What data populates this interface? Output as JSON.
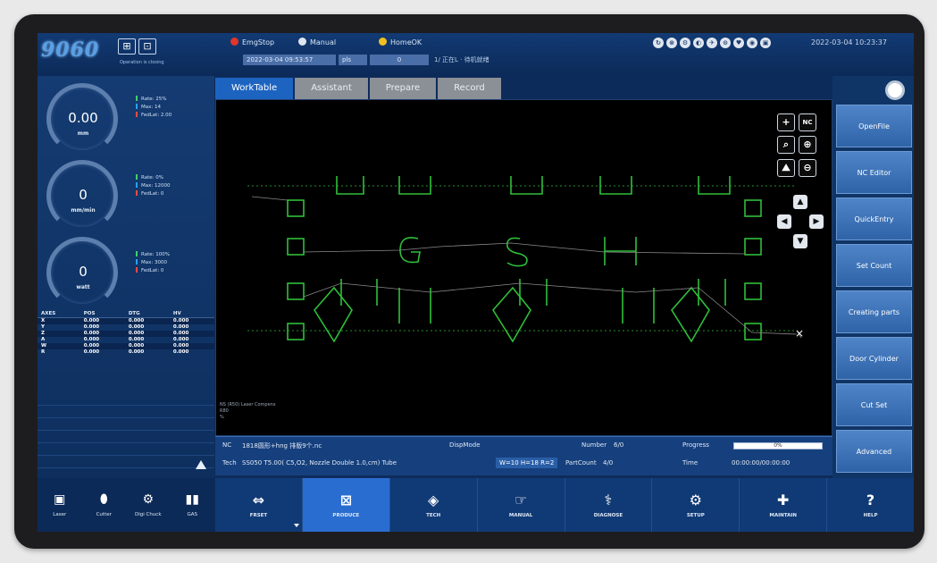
{
  "app": {
    "logo_text": "9060",
    "lock_caption": "Operation is closing"
  },
  "topbar": {
    "chips": [
      {
        "label": "EmgStop",
        "color": "#e0362b"
      },
      {
        "label": "Manual",
        "color": "#dfe6ef"
      },
      {
        "label": "HomeOK",
        "color": "#f0c020"
      }
    ],
    "time_field": "2022-03-04 09:53:57",
    "mode_field": "pls",
    "value_field": "0",
    "status_text": "1/ 正在L · 待机就绪",
    "datetime": "2022-03-04 10:23:37",
    "sys_icons": [
      "↻",
      "⊗",
      "⚙",
      "◐",
      "✈",
      "⊙",
      "♥",
      "◉",
      "▣"
    ]
  },
  "gauges": [
    {
      "value": "0.00",
      "unit": "mm",
      "stats": [
        {
          "label": "Rate: 25%",
          "color": "#3fd06a"
        },
        {
          "label": "Max: 14",
          "color": "#2aa0ff"
        },
        {
          "label": "FedLat: 2.00",
          "color": "#ff4a3d"
        }
      ]
    },
    {
      "value": "0",
      "unit": "mm/min",
      "stats": [
        {
          "label": "Rate: 0%",
          "color": "#3fd06a"
        },
        {
          "label": "Max: 12000",
          "color": "#2aa0ff"
        },
        {
          "label": "FedLat: 0",
          "color": "#ff4a3d"
        }
      ]
    },
    {
      "value": "0",
      "unit": "watt",
      "stats": [
        {
          "label": "Rate: 100%",
          "color": "#3fd06a"
        },
        {
          "label": "Max: 3000",
          "color": "#2aa0ff"
        },
        {
          "label": "FedLat: 0",
          "color": "#ff4a3d"
        }
      ]
    }
  ],
  "axes": {
    "headers": [
      "AXES",
      "POS",
      "DTG",
      "HV"
    ],
    "rows": [
      [
        "X",
        "0.000",
        "0.000",
        "0.000"
      ],
      [
        "Y",
        "0.000",
        "0.000",
        "0.000"
      ],
      [
        "Z",
        "0.000",
        "0.000",
        "0.000"
      ],
      [
        "A",
        "0.000",
        "0.000",
        "0.000"
      ],
      [
        "W",
        "0.000",
        "0.000",
        "0.000"
      ],
      [
        "R",
        "0.000",
        "0.000",
        "0.000"
      ]
    ]
  },
  "left_buttons": [
    {
      "label": "Laser",
      "icon": "▣"
    },
    {
      "label": "Cutter",
      "icon": "⬮"
    },
    {
      "label": "Digi Chuck",
      "icon": "⚙"
    },
    {
      "label": "GAS",
      "icon": "▮▮"
    }
  ],
  "tabs": [
    "WorkTable",
    "Assistant",
    "Prepare",
    "Record"
  ],
  "canvas": {
    "note_lines": [
      "NS (R50) Laser Compens",
      "R80",
      "%"
    ],
    "view_buttons": {
      "zoom_in": "+",
      "nc": "NC",
      "zoom_fit": "⌕",
      "center": "⊕",
      "mirror": "⛰",
      "zoom_out": "⊖"
    },
    "nav": {
      "up": "▲",
      "left": "◀",
      "right": "▶",
      "down": "▼"
    }
  },
  "status_bar": {
    "nc_label": "NC",
    "nc_value": "1818圆形+hng 排版9个.nc",
    "disp_mode": "DispMode",
    "number_label": "Number",
    "number_value": "6/0",
    "progress_label": "Progress",
    "progress_value": "0%",
    "progress_fraction": 0,
    "tech_label": "Tech",
    "tech_value": "SS050 T5.00( C5,O2, Nozzle Double 1.0,cm) Tube",
    "dims_value": "W=10 H=18 R=2",
    "partcount_label": "PartCount",
    "partcount_value": "4/0",
    "time_label": "Time",
    "time_value": "00:00:00/00:00:00"
  },
  "right_buttons": [
    "OpenFile",
    "NC Editor",
    "QuickEntry",
    "Set Count",
    "Creating parts",
    "Door Cylinder",
    "Cut Set",
    "Advanced"
  ],
  "bottom_nav": [
    {
      "label": "FRSET",
      "icon": "⇔"
    },
    {
      "label": "PRODUCE",
      "icon": "⊠"
    },
    {
      "label": "TECH",
      "icon": "◈"
    },
    {
      "label": "MANUAL",
      "icon": "☞"
    },
    {
      "label": "DIAGNOSE",
      "icon": "⚕"
    },
    {
      "label": "SETUP",
      "icon": "⚙"
    },
    {
      "label": "MAINTAIN",
      "icon": "✚"
    },
    {
      "label": "HELP",
      "icon": "?"
    }
  ],
  "colors": {
    "accent": "#1d64c1",
    "canvas_bg": "#000000",
    "path_green": "#2fbf3a"
  }
}
